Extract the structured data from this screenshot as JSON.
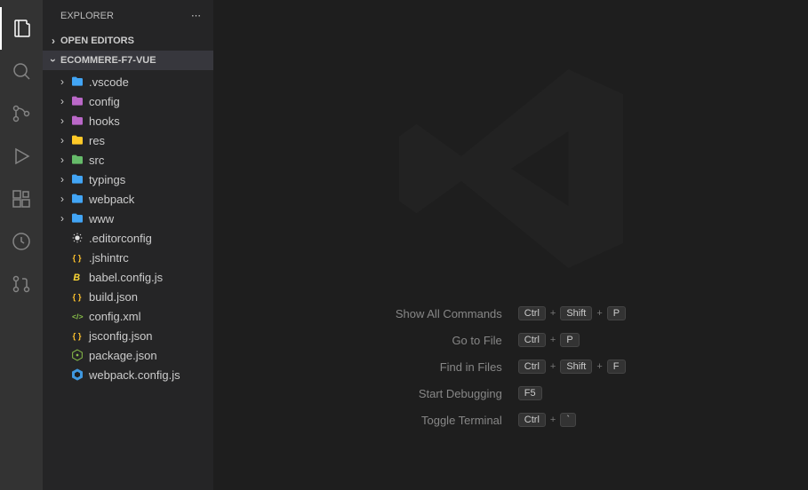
{
  "sidebar": {
    "title": "EXPLORER",
    "sections": {
      "openEditors": "OPEN EDITORS",
      "project": "ECOMMERE-F7-VUE"
    }
  },
  "activity": {
    "items": [
      "explorer",
      "search",
      "source-control",
      "run-debug",
      "extensions",
      "remote",
      "git-pr"
    ]
  },
  "tree": [
    {
      "type": "folder",
      "name": ".vscode",
      "icon": "folder-vscode",
      "color": "#42a5f5"
    },
    {
      "type": "folder",
      "name": "config",
      "icon": "folder-config",
      "color": "#ba68c8"
    },
    {
      "type": "folder",
      "name": "hooks",
      "icon": "folder-hooks",
      "color": "#ba68c8"
    },
    {
      "type": "folder",
      "name": "res",
      "icon": "folder-resource",
      "color": "#ffca28"
    },
    {
      "type": "folder",
      "name": "src",
      "icon": "folder-src",
      "color": "#66bb6a"
    },
    {
      "type": "folder",
      "name": "typings",
      "icon": "folder-typings",
      "color": "#42a5f5"
    },
    {
      "type": "folder",
      "name": "webpack",
      "icon": "folder-webpack",
      "color": "#42a5f5"
    },
    {
      "type": "folder",
      "name": "www",
      "icon": "folder-www",
      "color": "#42a5f5"
    },
    {
      "type": "file",
      "name": ".editorconfig",
      "icon": "editorconfig",
      "color": "#e0e0e0"
    },
    {
      "type": "file",
      "name": ".jshintrc",
      "icon": "json",
      "color": "#fbc02d"
    },
    {
      "type": "file",
      "name": "babel.config.js",
      "icon": "babel",
      "color": "#fdd835"
    },
    {
      "type": "file",
      "name": "build.json",
      "icon": "json",
      "color": "#fbc02d"
    },
    {
      "type": "file",
      "name": "config.xml",
      "icon": "xml",
      "color": "#8bc34a"
    },
    {
      "type": "file",
      "name": "jsconfig.json",
      "icon": "json",
      "color": "#fbc02d"
    },
    {
      "type": "file",
      "name": "package.json",
      "icon": "npm",
      "color": "#8bc34a"
    },
    {
      "type": "file",
      "name": "webpack.config.js",
      "icon": "webpack",
      "color": "#42a5f5"
    }
  ],
  "commands": [
    {
      "label": "Show All Commands",
      "keys": [
        "Ctrl",
        "Shift",
        "P"
      ]
    },
    {
      "label": "Go to File",
      "keys": [
        "Ctrl",
        "P"
      ]
    },
    {
      "label": "Find in Files",
      "keys": [
        "Ctrl",
        "Shift",
        "F"
      ]
    },
    {
      "label": "Start Debugging",
      "keys": [
        "F5"
      ]
    },
    {
      "label": "Toggle Terminal",
      "keys": [
        "Ctrl",
        "`"
      ]
    }
  ]
}
